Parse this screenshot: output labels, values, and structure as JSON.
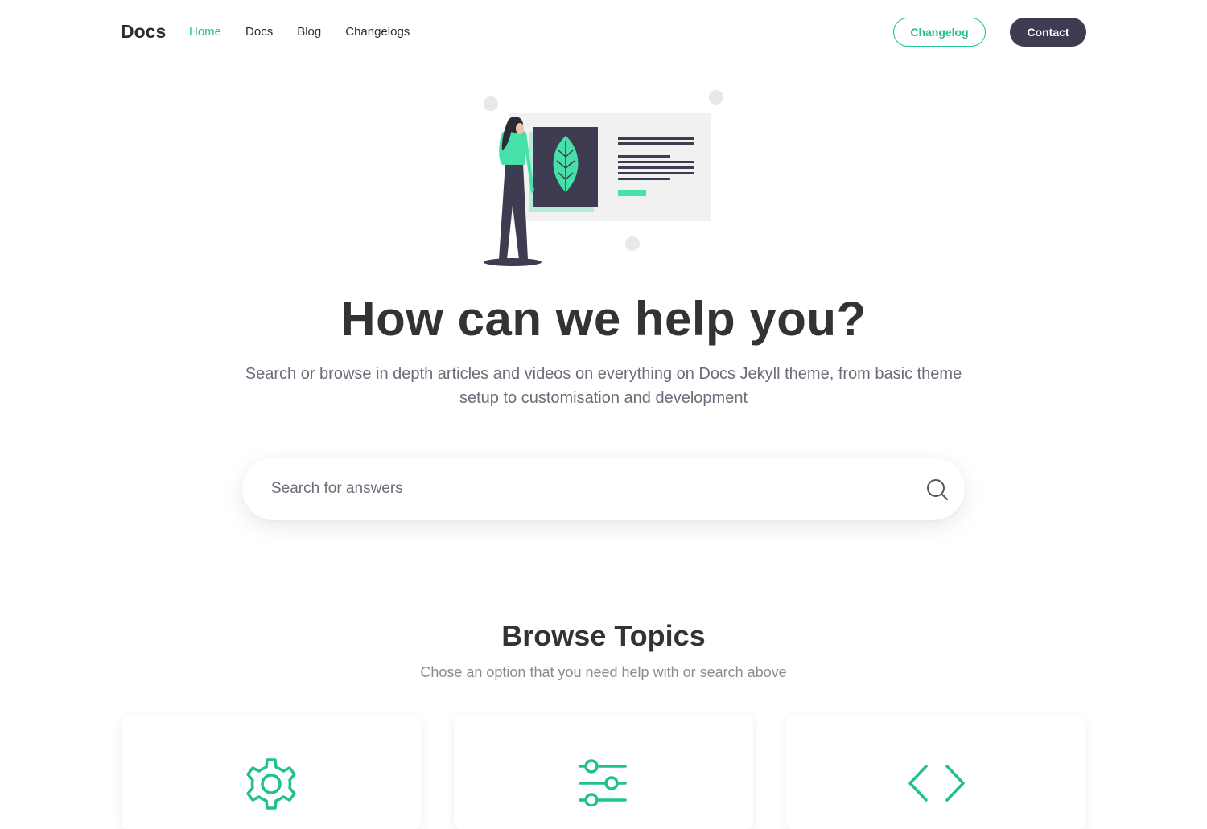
{
  "nav": {
    "brand": "Docs",
    "links": [
      "Home",
      "Docs",
      "Blog",
      "Changelogs"
    ],
    "active_index": 0,
    "changelog_button": "Changelog",
    "contact_button": "Contact"
  },
  "hero": {
    "title": "How can we help you?",
    "subtitle": "Search or browse in depth articles and videos on everything on Docs Jekyll theme, from basic theme setup to customisation and development"
  },
  "search": {
    "placeholder": "Search for answers",
    "icon": "search-icon"
  },
  "topics": {
    "title": "Browse Topics",
    "subtitle": "Chose an option that you need help with or search above",
    "cards": [
      {
        "icon": "gear-icon"
      },
      {
        "icon": "sliders-icon"
      },
      {
        "icon": "code-icon"
      }
    ]
  },
  "colors": {
    "accent": "#21c18a",
    "dark": "#3d3c51"
  }
}
